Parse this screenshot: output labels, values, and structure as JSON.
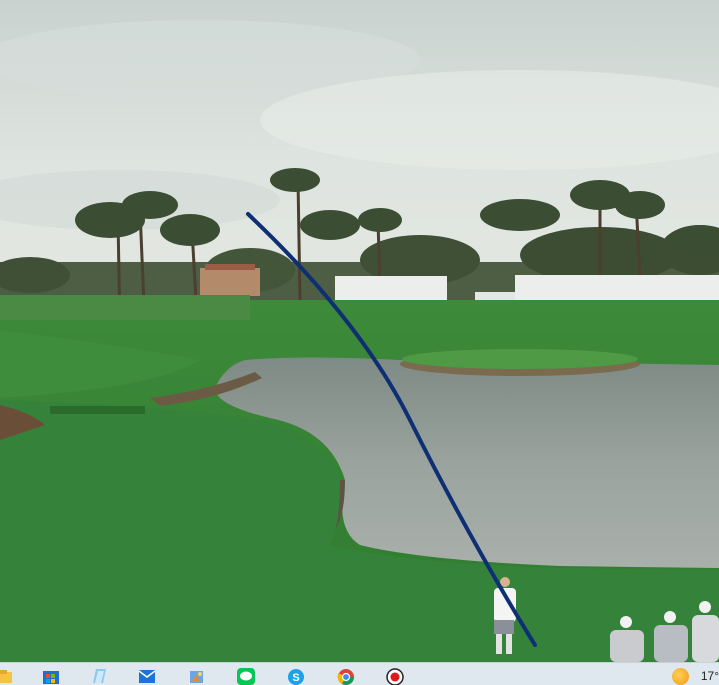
{
  "scene": {
    "description_label": "",
    "shot_tracer_color": "#0e2f73"
  },
  "taskbar": {
    "pinned_apps": [
      {
        "name": "file-explorer-icon"
      },
      {
        "name": "microsoft-store-icon"
      },
      {
        "name": "notepad-icon"
      },
      {
        "name": "mail-icon"
      },
      {
        "name": "photos-icon"
      },
      {
        "name": "line-app-icon"
      },
      {
        "name": "skype-icon"
      },
      {
        "name": "chrome-icon"
      },
      {
        "name": "screen-recorder-icon"
      }
    ],
    "weather_temp": "17°"
  }
}
